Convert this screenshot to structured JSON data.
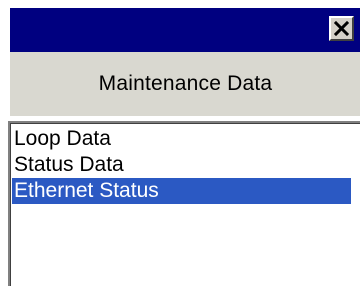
{
  "window": {
    "close_icon": "close-icon",
    "colors": {
      "titlebar": "#000080",
      "header_band": "#d9d8d0",
      "selection": "#2b59c3"
    }
  },
  "header": {
    "title": "Maintenance Data"
  },
  "list": {
    "items": [
      {
        "label": "Loop Data",
        "selected": false
      },
      {
        "label": "Status Data",
        "selected": false
      },
      {
        "label": "Ethernet Status",
        "selected": true
      }
    ]
  }
}
